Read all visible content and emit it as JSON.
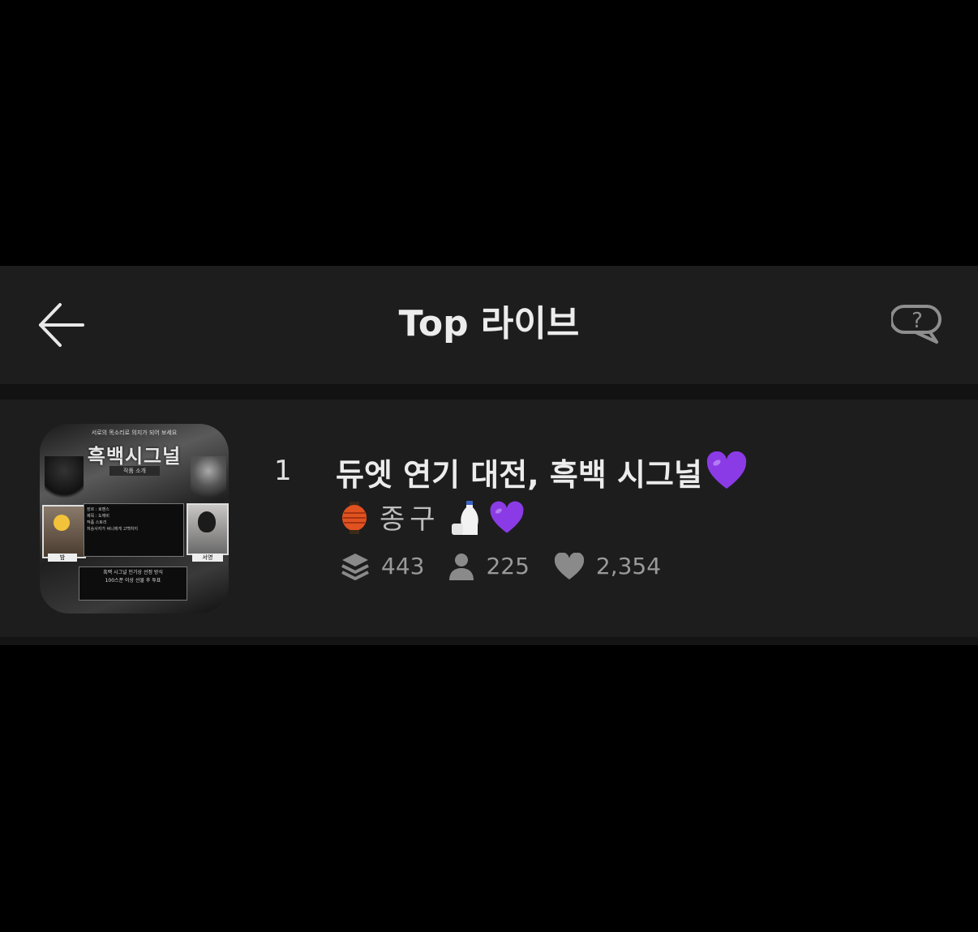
{
  "header": {
    "title": "Top 라이브",
    "back_icon": "arrow-left-icon",
    "help_icon": "question-bubble-icon"
  },
  "list": {
    "items": [
      {
        "rank": "1",
        "title": "듀엣 연기 대전, 흑백 시그널",
        "title_emoji": "purple-heart-icon",
        "host_prefix_icon": "red-lantern-icon",
        "host_name": "종구",
        "host_suffix_icons": [
          "sake-bottle-icon",
          "purple-heart-icon"
        ],
        "thumbnail": {
          "top_text": "서로의 목소리로 의지가 되어 보세요",
          "title": "흑백시그널",
          "subtitle": "작품 소개",
          "middle_lines": [
            "장르 : 로맨스",
            "제목 : 도깨비",
            "작품 스토리",
            "저승사자가 써니에게 고백하지"
          ],
          "bottom_lines": [
            "흑백 시그널 인기상 선정 방식",
            "100스푼 이상 선물 후 투표"
          ],
          "left_label": "밤",
          "right_label": "서영"
        },
        "stats": {
          "layers_icon": "layers-icon",
          "layers": "443",
          "listeners_icon": "person-icon",
          "listeners": "225",
          "likes_icon": "heart-icon",
          "likes": "2,354"
        }
      }
    ]
  },
  "colors": {
    "background": "#000000",
    "panel": "#1d1d1e",
    "text_primary": "#ececec",
    "text_secondary": "#9a9a9a",
    "accent_purple": "#8b3be6",
    "lantern": "#e0521f"
  }
}
